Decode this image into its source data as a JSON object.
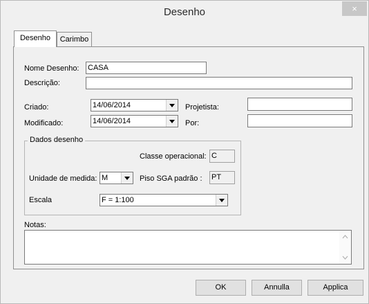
{
  "window": {
    "title": "Desenho",
    "close_glyph": "×"
  },
  "tabs": [
    {
      "label": "Desenho",
      "active": true
    },
    {
      "label": "Carimbo",
      "active": false
    }
  ],
  "form": {
    "nome_label": "Nome Desenho:",
    "nome_value": "CASA",
    "descricao_label": "Descrição:",
    "descricao_value": "",
    "criado_label": "Criado:",
    "criado_value": "14/06/2014",
    "projetista_label": "Projetista:",
    "projetista_value": "",
    "modificado_label": "Modificado:",
    "modificado_value": "14/06/2014",
    "por_label": "Por:",
    "por_value": ""
  },
  "dados": {
    "legend": "Dados desenho",
    "classe_label": "Classe operacional:",
    "classe_value": "C",
    "unidade_label": "Unidade de medida:",
    "unidade_value": "M",
    "piso_label": "Piso SGA padrão :",
    "piso_value": "PT",
    "escala_label": "Escala",
    "escala_value": "F = 1:100"
  },
  "notas": {
    "label": "Notas:",
    "value": ""
  },
  "buttons": {
    "ok": "OK",
    "annulla": "Annulla",
    "applica": "Applica"
  }
}
